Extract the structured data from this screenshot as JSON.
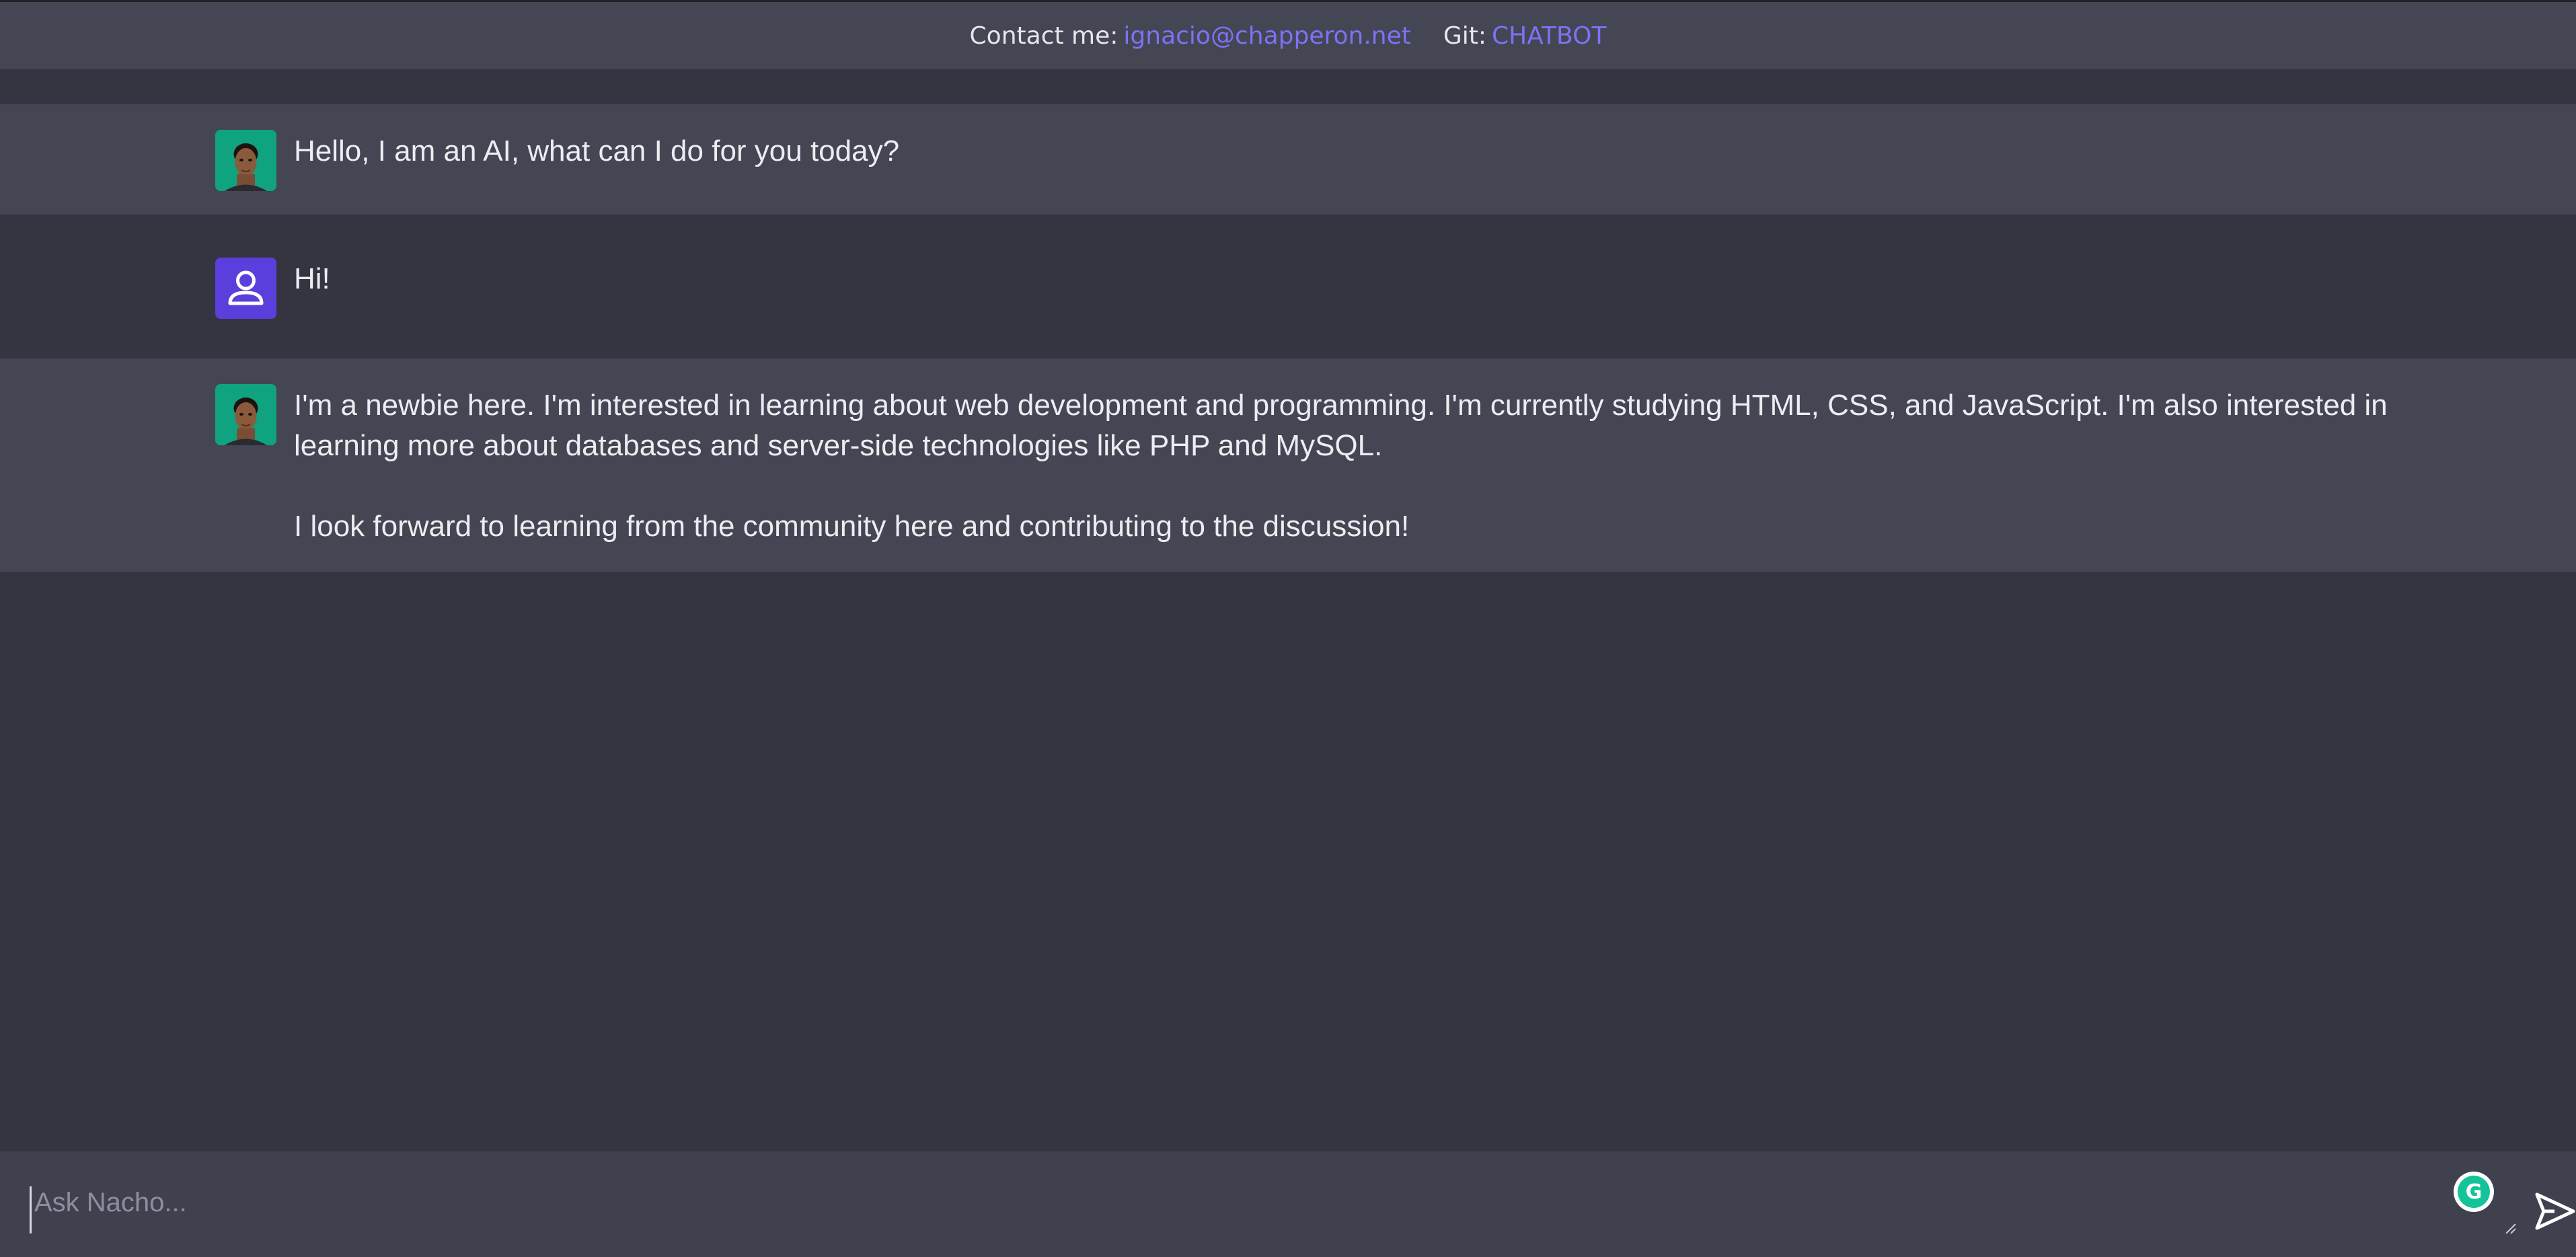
{
  "header": {
    "contact_label": "Contact me:",
    "contact_email": "ignacio@chapperon.net",
    "git_label": "Git:",
    "git_link": "CHATBOT"
  },
  "messages": [
    {
      "role": "ai",
      "icon": "bot-avatar-icon",
      "paragraphs": [
        "Hello, I am an AI, what can I do for you today?"
      ]
    },
    {
      "role": "user",
      "icon": "user-avatar-icon",
      "paragraphs": [
        "Hi!"
      ]
    },
    {
      "role": "ai",
      "icon": "bot-avatar-icon",
      "paragraphs": [
        "I'm a newbie here. I'm interested in learning about web development and programming. I'm currently studying HTML, CSS, and JavaScript. I'm also interested in learning more about databases and server-side technologies like PHP and MySQL.",
        "I look forward to learning from the community here and contributing to the discussion!"
      ]
    }
  ],
  "composer": {
    "placeholder": "Ask Nacho...",
    "value": "",
    "grammarly_icon": "grammarly-icon",
    "send_icon": "send-icon"
  },
  "colors": {
    "accent": "#7d72f4",
    "bot_avatar_bg": "#10a37f",
    "user_avatar_bg": "#5b3fdc",
    "ai_row_bg": "#444654",
    "user_row_bg": "#343541",
    "page_bg": "#343541",
    "composer_bg": "#40414f"
  }
}
